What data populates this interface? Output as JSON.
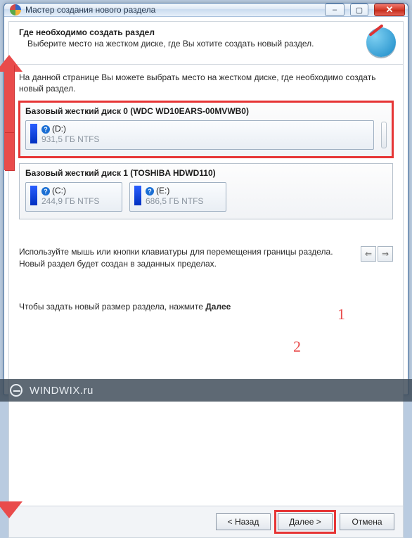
{
  "window": {
    "title": "Мастер создания нового раздела",
    "btn_min": "–",
    "btn_max": "▢",
    "btn_close": "✕"
  },
  "header": {
    "title": "Где необходимо создать раздел",
    "subtitle": "Выберите место на жестком диске, где Вы хотите создать новый раздел."
  },
  "desc": "На данной странице Вы можете выбрать место на жестком диске, где необходимо создать новый раздел.",
  "disks": [
    {
      "selected": true,
      "title": "Базовый жесткий диск 0 (WDC WD10EARS-00MVWB0)",
      "partitions": [
        {
          "label": "(D:)",
          "size": "931,5 ГБ NTFS",
          "wide": true
        }
      ],
      "has_handle": true
    },
    {
      "selected": false,
      "title": "Базовый жесткий диск 1 (TOSHIBA HDWD110)",
      "partitions": [
        {
          "label": "(C:)",
          "size": "244,9 ГБ NTFS",
          "wide": false
        },
        {
          "label": "(E:)",
          "size": "686,5 ГБ NTFS",
          "wide": false
        }
      ],
      "has_handle": false
    }
  ],
  "tip": "Используйте мышь или кнопки клавиатуры для перемещения границы раздела. Новый раздел будет создан в заданных пределах.",
  "press_prefix": "Чтобы задать новый размер раздела, нажмите ",
  "press_bold": "Далее",
  "buttons": {
    "back": "< Назад",
    "next": "Далее >",
    "cancel": "Отмена"
  },
  "nav": {
    "prev": "⇐",
    "next": "⇒"
  },
  "annotations": {
    "one": "1",
    "two": "2"
  },
  "watermark": "WINDWIX.ru"
}
